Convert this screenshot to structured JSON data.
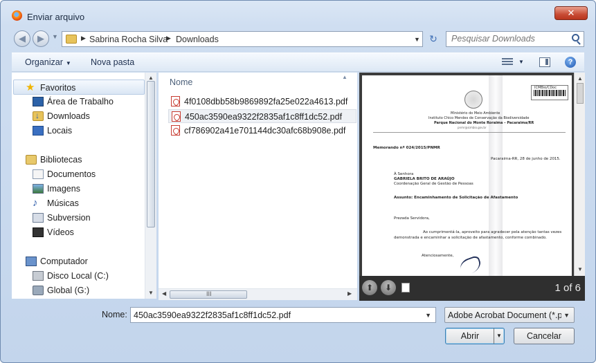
{
  "window": {
    "title": "Enviar arquivo",
    "close_label": "✕"
  },
  "address": {
    "crumbs": [
      "Sabrina Rocha Silva",
      "Downloads"
    ],
    "search_placeholder": "Pesquisar Downloads"
  },
  "toolbar": {
    "organize": "Organizar",
    "new_folder": "Nova pasta",
    "help": "?"
  },
  "nav": {
    "favorites": "Favoritos",
    "desktop": "Área de Trabalho",
    "downloads": "Downloads",
    "places": "Locais",
    "libraries": "Bibliotecas",
    "documents": "Documentos",
    "images": "Imagens",
    "music": "Músicas",
    "subversion": "Subversion",
    "videos": "Vídeos",
    "computer": "Computador",
    "disk_c": "Disco Local (C:)",
    "disk_g": "Global (G:)"
  },
  "files": {
    "column": "Nome",
    "items": [
      "4f0108dbb58b9869892fa25e022a4613.pdf",
      "450ac3590ea9322f2835af1c8ff1dc52.pdf",
      "cf786902a41e701144dc30afc68b908e.pdf"
    ],
    "scroll_grip": "III"
  },
  "preview": {
    "page_count": "1 of 6",
    "doc": {
      "stamp": "ICMBio/CDoc",
      "header1": "Ministério do Meio Ambiente",
      "header2": "Instituto Chico Mendes de Conservação da Biodiversidade",
      "header3": "Parque Nacional do Monte Roraima – Pacaraima/RR",
      "email": "pnmr@icmbio.gov.br",
      "memo": "Memorando nº 024/2015/PNMR",
      "date": "Pacaraima-RR, 28 de junho de 2015.",
      "to": "À Senhora",
      "name": "GABRIELA BRITO DE ARAÚJO",
      "dept": "Coordenação Geral de Gestão de Pessoas",
      "subject": "Assunto: Encaminhamento de Solicitação de Afastamento",
      "greeting": "Prezada Servidora,",
      "body1": "Ao cumprimentá-la, aproveito para agradecer pela atenção tantas vezes",
      "body2": "demonstrada e encaminhar a solicitação de afastamento, conforme combinado.",
      "closing": "Atenciosamente,"
    }
  },
  "bottom": {
    "name_label": "Nome:",
    "name_value": "450ac3590ea9322f2835af1c8ff1dc52.pdf",
    "type_value": "Adobe Acrobat Document (*.pdf)",
    "open": "Abrir",
    "cancel": "Cancelar"
  }
}
